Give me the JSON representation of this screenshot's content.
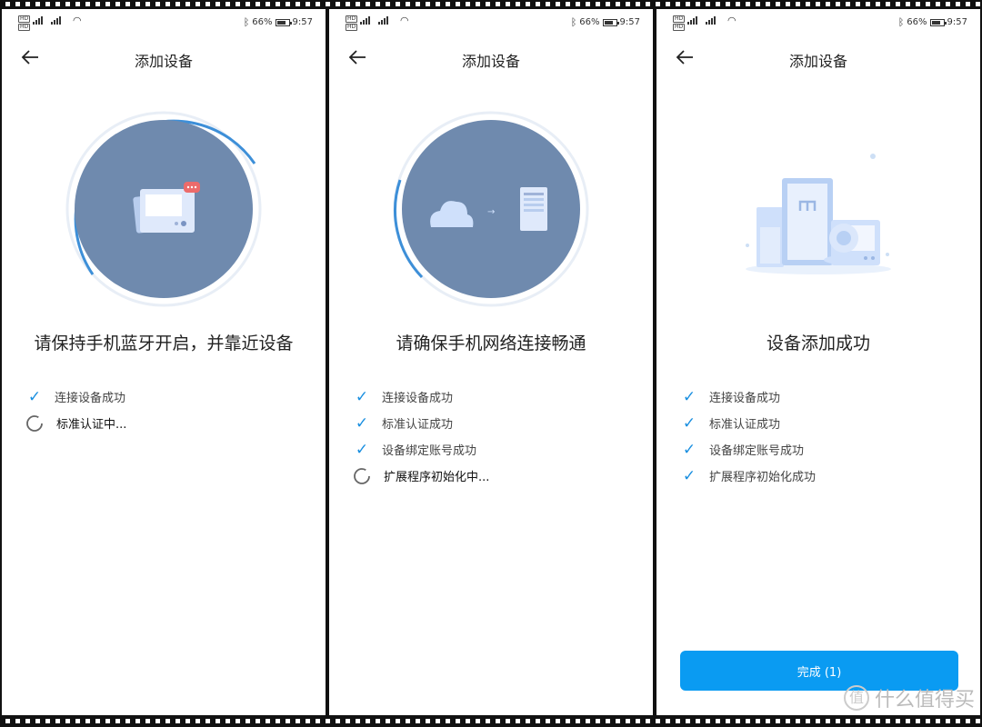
{
  "statusbar": {
    "sim1": "HD",
    "sim2": "HD",
    "net1": "4G",
    "net2": "4G",
    "battery": "66%",
    "time": "9:57"
  },
  "panels": [
    {
      "title": "添加设备",
      "heading": "请保持手机蓝牙开启，并靠近设备",
      "steps": [
        {
          "label": "连接设备成功",
          "state": "done"
        },
        {
          "label": "标准认证中...",
          "state": "loading"
        }
      ]
    },
    {
      "title": "添加设备",
      "heading": "请确保手机网络连接畅通",
      "steps": [
        {
          "label": "连接设备成功",
          "state": "done"
        },
        {
          "label": "标准认证成功",
          "state": "done"
        },
        {
          "label": "设备绑定账号成功",
          "state": "done"
        },
        {
          "label": "扩展程序初始化中...",
          "state": "loading"
        }
      ]
    },
    {
      "title": "添加设备",
      "heading": "设备添加成功",
      "steps": [
        {
          "label": "连接设备成功",
          "state": "done"
        },
        {
          "label": "标准认证成功",
          "state": "done"
        },
        {
          "label": "设备绑定账号成功",
          "state": "done"
        },
        {
          "label": "扩展程序初始化成功",
          "state": "done"
        }
      ],
      "button": "完成 (1)"
    }
  ],
  "watermark": {
    "badge": "值",
    "text": "什么值得买"
  },
  "colors": {
    "accent": "#0a9bf2",
    "check": "#1a8fe0",
    "circle": "#6f8aae",
    "ring": "#3d8fd8"
  },
  "icons": [
    "back-arrow-icon",
    "checkmark-icon",
    "loading-spinner-icon",
    "bluetooth-icon",
    "wifi-icon",
    "battery-icon"
  ]
}
